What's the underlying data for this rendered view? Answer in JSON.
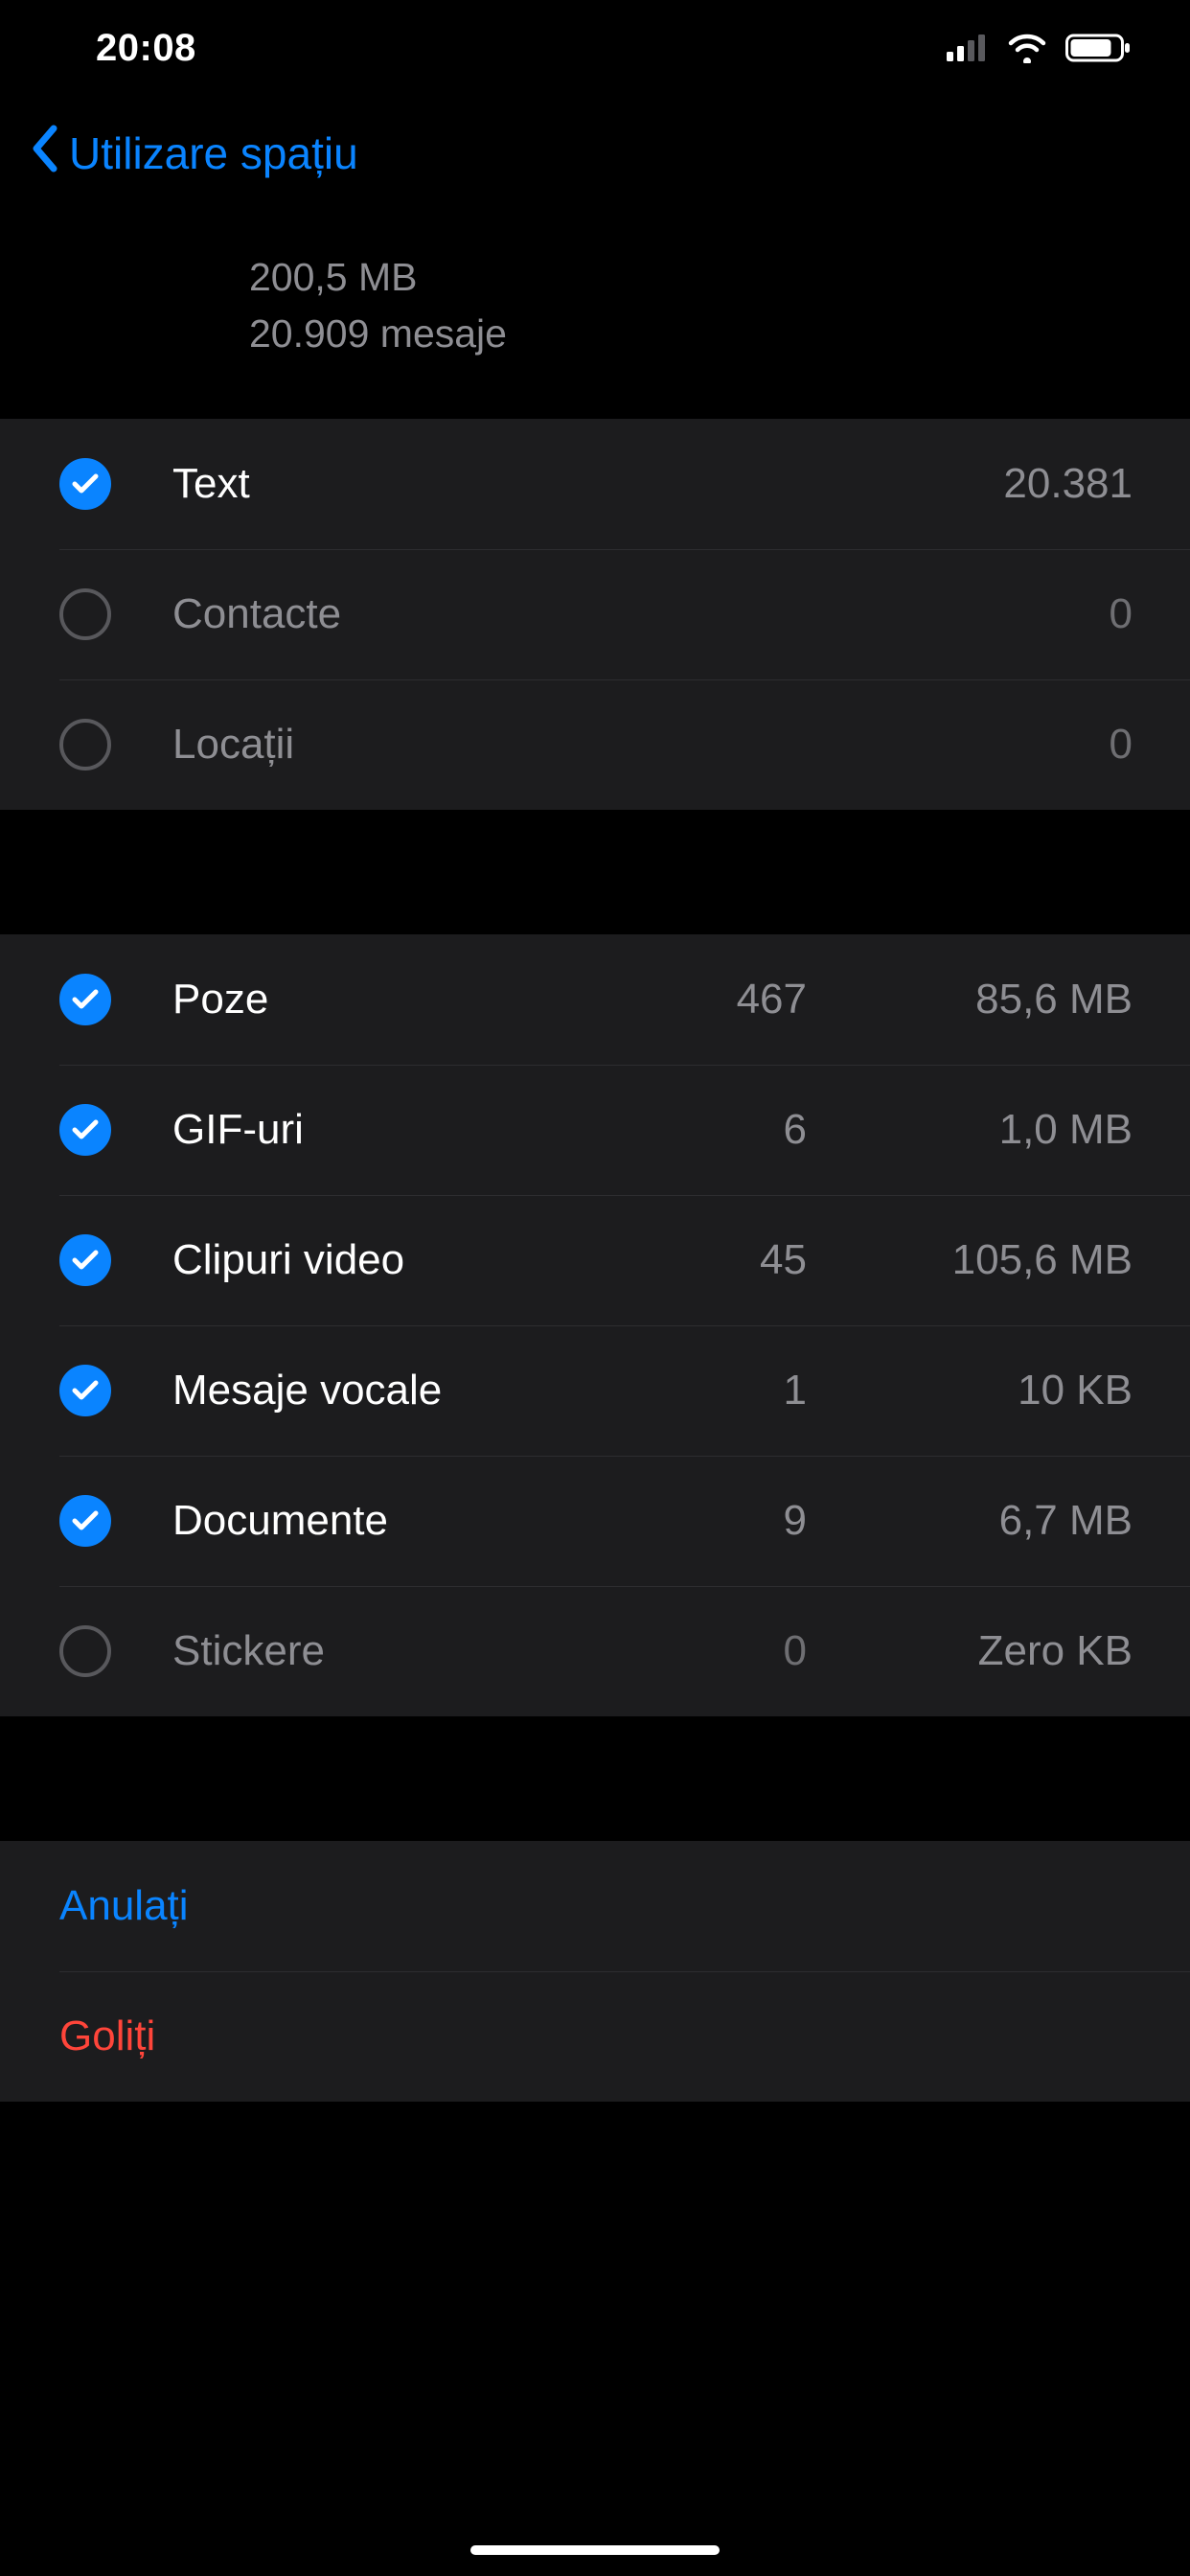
{
  "status": {
    "time": "20:08"
  },
  "nav": {
    "back_label": "Utilizare spațiu"
  },
  "summary": {
    "size": "200,5 MB",
    "messages": "20.909 mesaje"
  },
  "groups": [
    [
      {
        "checked": true,
        "label": "Text",
        "count": "20.381",
        "size": ""
      },
      {
        "checked": false,
        "label": "Contacte",
        "count": "0",
        "size": ""
      },
      {
        "checked": false,
        "label": "Locații",
        "count": "0",
        "size": ""
      }
    ],
    [
      {
        "checked": true,
        "label": "Poze",
        "count": "467",
        "size": "85,6 MB"
      },
      {
        "checked": true,
        "label": "GIF-uri",
        "count": "6",
        "size": "1,0 MB"
      },
      {
        "checked": true,
        "label": "Clipuri video",
        "count": "45",
        "size": "105,6 MB"
      },
      {
        "checked": true,
        "label": "Mesaje vocale",
        "count": "1",
        "size": "10 KB"
      },
      {
        "checked": true,
        "label": "Documente",
        "count": "9",
        "size": "6,7 MB"
      },
      {
        "checked": false,
        "label": "Stickere",
        "count": "0",
        "size": "Zero KB"
      }
    ]
  ],
  "actions": {
    "cancel": "Anulați",
    "clear": "Goliți"
  }
}
